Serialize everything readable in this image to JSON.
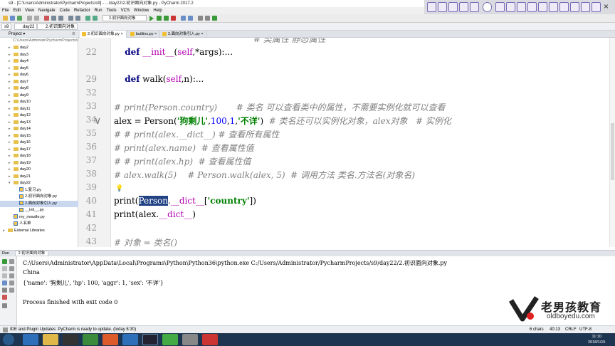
{
  "window": {
    "title": "s9 - [C:\\Users\\Administrator\\PycharmProjects\\s9] - ...\\day22\\2.初识面向对象.py - PyCharm 2017.2"
  },
  "menu": [
    "File",
    "Edit",
    "View",
    "Navigate",
    "Code",
    "Refactor",
    "Run",
    "Tools",
    "VCS",
    "Window",
    "Help"
  ],
  "breadcrumbs": [
    "s9",
    "day22",
    "2.初识面向对象"
  ],
  "project_panel": {
    "label": "Project",
    "path": "C:\\Users\\Administr\\PycharmProjects\\s9"
  },
  "tabs": [
    {
      "label": "2.初识面向对象.py",
      "active": true
    },
    {
      "label": "builtins.py",
      "active": false
    },
    {
      "label": "2.面向对象引入.py",
      "active": false
    }
  ],
  "tree": [
    {
      "label": "day2",
      "kind": "folder",
      "depth": 1
    },
    {
      "label": "day3",
      "kind": "folder",
      "depth": 1
    },
    {
      "label": "day4",
      "kind": "folder",
      "depth": 1
    },
    {
      "label": "day5",
      "kind": "folder",
      "depth": 1
    },
    {
      "label": "day6",
      "kind": "folder",
      "depth": 1
    },
    {
      "label": "day7",
      "kind": "folder",
      "depth": 1
    },
    {
      "label": "day8",
      "kind": "folder",
      "depth": 1
    },
    {
      "label": "day9",
      "kind": "folder",
      "depth": 1
    },
    {
      "label": "day10",
      "kind": "folder",
      "depth": 1
    },
    {
      "label": "day11",
      "kind": "folder",
      "depth": 1
    },
    {
      "label": "day12",
      "kind": "folder",
      "depth": 1
    },
    {
      "label": "day13",
      "kind": "folder",
      "depth": 1
    },
    {
      "label": "day14",
      "kind": "folder",
      "depth": 1
    },
    {
      "label": "day15",
      "kind": "folder",
      "depth": 1
    },
    {
      "label": "day16",
      "kind": "folder",
      "depth": 1
    },
    {
      "label": "day17",
      "kind": "folder",
      "depth": 1
    },
    {
      "label": "day18",
      "kind": "folder",
      "depth": 1
    },
    {
      "label": "day19",
      "kind": "folder",
      "depth": 1
    },
    {
      "label": "day20",
      "kind": "folder",
      "depth": 1
    },
    {
      "label": "day21",
      "kind": "folder",
      "depth": 1
    },
    {
      "label": "day22",
      "kind": "folder",
      "depth": 1,
      "open": true
    },
    {
      "label": "1.复习.py",
      "kind": "file",
      "depth": 2
    },
    {
      "label": "2.初识面向对象.py",
      "kind": "file",
      "depth": 2
    },
    {
      "label": "2.面向对象引入.py",
      "kind": "file",
      "depth": 2,
      "selected": true
    },
    {
      "label": "__init__.py",
      "kind": "file",
      "depth": 2
    },
    {
      "label": "my_moudle.py",
      "kind": "file",
      "depth": 1
    },
    {
      "label": "人名单",
      "kind": "file",
      "depth": 1
    },
    {
      "label": "External Libraries",
      "kind": "lib",
      "depth": 0
    }
  ],
  "code_lines": [
    {
      "no": "22",
      "html": "    <span class=\"kw\">def</span> <span class=\"dn\">__init__</span>(<span class=\"dn\">self</span>,*args):..."
    },
    {
      "no": "",
      "html": ""
    },
    {
      "no": "29",
      "html": "    <span class=\"kw\">def</span> walk(<span class=\"dn\">self</span>,n):..."
    },
    {
      "no": "32",
      "html": ""
    },
    {
      "no": "33",
      "html": "<span class=\"cm\"># print(Person.country)       # 类名 可以查看类中的属性，不需要实例化就可以查看</span>"
    },
    {
      "no": "34",
      "html": "alex = Person(<span class=\"st\">'狗剩儿'</span>,<span class=\"nm\">100</span>,<span class=\"nm\">1</span>,<span class=\"st\">'不详'</span>)  <span class=\"cm\"># 类名还可以实例化对象，alex对象   # 实例化</span>"
    },
    {
      "no": "35",
      "html": "<span class=\"cm\"># # print(alex.__dict__) # 查看所有属性</span>"
    },
    {
      "no": "36",
      "html": "<span class=\"cm\"># print(alex.name)  # 查看属性值</span>"
    },
    {
      "no": "37",
      "html": "<span class=\"cm\"># # print(alex.hp)  # 查看属性值</span>"
    },
    {
      "no": "38",
      "html": "<span class=\"cm\"># alex.walk(5)    # Person.walk(alex, 5)  # 调用方法 类名.方法名(对象名)</span>"
    },
    {
      "no": "39",
      "html": ""
    },
    {
      "no": "40",
      "html": "print(<span style=\"background:#214283;color:#fff\">Person</span>.<span class=\"dn\">__dict__</span>[<span class=\"st\">'country'</span>])"
    },
    {
      "no": "41",
      "html": "print(alex.<span class=\"dn\">__dict__</span>)"
    },
    {
      "no": "42",
      "html": ""
    },
    {
      "no": "43",
      "html": "<span class=\"cm\"># 对象 = 类名()</span>"
    }
  ],
  "top_comment": "# 类属性 静态属性",
  "run": {
    "tab": "2.初识面向对象",
    "label": "Run",
    "lines": [
      "C:\\Users\\Administrator\\AppData\\Local\\Programs\\Python\\Python36\\python.exe C:/Users/Administrator/PycharmProjects/s9/day22/2.初识面向对象.py",
      "China",
      "{'name': '狗剩儿', 'hp': 100, 'aggr': 1, 'sex': '不详'}",
      "",
      "Process finished with exit code 0"
    ]
  },
  "status": {
    "message": "IDE and Plugin Updates: PyCharm is ready to update. (today 8:30)",
    "chars": "6 chars",
    "pos": "40:13",
    "crlf": "CRLF",
    "enc": "UTF-8"
  },
  "watermark": {
    "cn": "老男孩教育",
    "url": "oldboyedu.com"
  },
  "clock": {
    "time": "11:10",
    "date": "2018/1/15"
  }
}
